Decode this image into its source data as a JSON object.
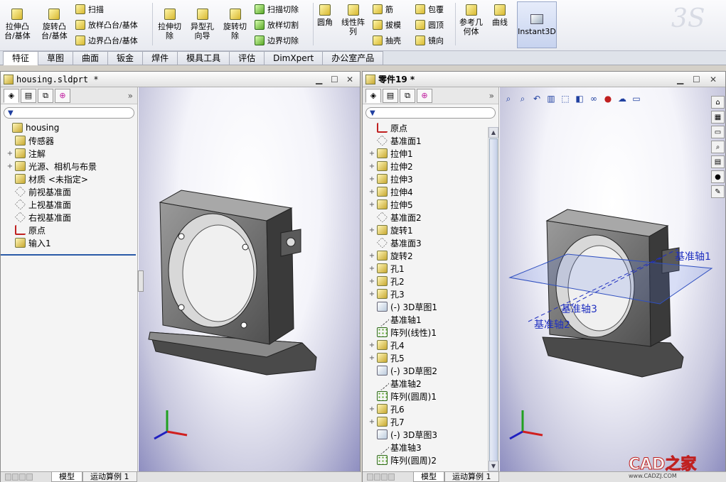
{
  "ribbon": {
    "big": [
      {
        "id": "extrude-boss",
        "label": "拉伸凸\n台/基体"
      },
      {
        "id": "revolve-boss",
        "label": "旋转凸\n台/基体"
      },
      {
        "id": "extrude-cut",
        "label": "拉伸切\n除"
      },
      {
        "id": "hole-wizard",
        "label": "异型孔\n向导"
      },
      {
        "id": "revolve-cut",
        "label": "旋转切\n除"
      },
      {
        "id": "fillet",
        "label": "圆角"
      },
      {
        "id": "linear-pattern",
        "label": "线性阵\n列"
      },
      {
        "id": "ref-geometry",
        "label": "参考几\n何体"
      },
      {
        "id": "curves",
        "label": "曲线"
      }
    ],
    "small": [
      {
        "id": "sweep",
        "label": "扫描"
      },
      {
        "id": "loft",
        "label": "放样凸台/基体"
      },
      {
        "id": "boundary-boss",
        "label": "边界凸台/基体"
      },
      {
        "id": "swept-cut",
        "label": "扫描切除"
      },
      {
        "id": "lofted-cut",
        "label": "放样切割"
      },
      {
        "id": "boundary-cut",
        "label": "边界切除"
      },
      {
        "id": "rib",
        "label": "筋"
      },
      {
        "id": "draft",
        "label": "拔模"
      },
      {
        "id": "shell",
        "label": "抽壳"
      },
      {
        "id": "wrap",
        "label": "包覆"
      },
      {
        "id": "dome",
        "label": "圆顶"
      },
      {
        "id": "mirror",
        "label": "镜向"
      }
    ],
    "instant3d": "Instant3D"
  },
  "tabs": [
    "特征",
    "草图",
    "曲面",
    "钣金",
    "焊件",
    "模具工具",
    "评估",
    "DimXpert",
    "办公室产品"
  ],
  "left_window": {
    "title": "housing.sldprt *",
    "tree": [
      {
        "label": "housing",
        "expand": "",
        "icon": "part",
        "indent": 0
      },
      {
        "label": "传感器",
        "expand": "",
        "icon": "feat",
        "indent": 1
      },
      {
        "label": "注解",
        "expand": "+",
        "icon": "feat",
        "indent": 1
      },
      {
        "label": "光源、相机与布景",
        "expand": "+",
        "icon": "feat",
        "indent": 1
      },
      {
        "label": "材质 <未指定>",
        "expand": "",
        "icon": "feat",
        "indent": 1
      },
      {
        "label": "前视基准面",
        "expand": "",
        "icon": "plane",
        "indent": 1
      },
      {
        "label": "上视基准面",
        "expand": "",
        "icon": "plane",
        "indent": 1
      },
      {
        "label": "右视基准面",
        "expand": "",
        "icon": "plane",
        "indent": 1
      },
      {
        "label": "原点",
        "expand": "",
        "icon": "origin",
        "indent": 1
      },
      {
        "label": "输入1",
        "expand": "",
        "icon": "feat",
        "indent": 1
      }
    ],
    "bottom_tabs": [
      "模型",
      "运动算例 1"
    ]
  },
  "right_window": {
    "title": "零件19 *",
    "tree": [
      {
        "label": "原点",
        "expand": "",
        "icon": "origin"
      },
      {
        "label": "基准面1",
        "expand": "",
        "icon": "plane"
      },
      {
        "label": "拉伸1",
        "expand": "+",
        "icon": "feat"
      },
      {
        "label": "拉伸2",
        "expand": "+",
        "icon": "feat"
      },
      {
        "label": "拉伸3",
        "expand": "+",
        "icon": "feat"
      },
      {
        "label": "拉伸4",
        "expand": "+",
        "icon": "feat"
      },
      {
        "label": "拉伸5",
        "expand": "+",
        "icon": "feat"
      },
      {
        "label": "基准面2",
        "expand": "",
        "icon": "plane"
      },
      {
        "label": "旋转1",
        "expand": "+",
        "icon": "feat"
      },
      {
        "label": "基准面3",
        "expand": "",
        "icon": "plane"
      },
      {
        "label": "旋转2",
        "expand": "+",
        "icon": "feat"
      },
      {
        "label": "孔1",
        "expand": "+",
        "icon": "feat"
      },
      {
        "label": "孔2",
        "expand": "+",
        "icon": "feat"
      },
      {
        "label": "孔3",
        "expand": "+",
        "icon": "feat"
      },
      {
        "label": "(-) 3D草图1",
        "expand": "",
        "icon": "sketch"
      },
      {
        "label": "基准轴1",
        "expand": "",
        "icon": "axis"
      },
      {
        "label": "阵列(线性)1",
        "expand": "",
        "icon": "pattern"
      },
      {
        "label": "孔4",
        "expand": "+",
        "icon": "feat"
      },
      {
        "label": "孔5",
        "expand": "+",
        "icon": "feat"
      },
      {
        "label": "(-) 3D草图2",
        "expand": "",
        "icon": "sketch"
      },
      {
        "label": "基准轴2",
        "expand": "",
        "icon": "axis"
      },
      {
        "label": "阵列(圆周)1",
        "expand": "",
        "icon": "pattern"
      },
      {
        "label": "孔6",
        "expand": "+",
        "icon": "feat"
      },
      {
        "label": "孔7",
        "expand": "+",
        "icon": "feat"
      },
      {
        "label": "(-) 3D草图3",
        "expand": "",
        "icon": "sketch"
      },
      {
        "label": "基准轴3",
        "expand": "",
        "icon": "axis"
      },
      {
        "label": "阵列(圆周)2",
        "expand": "",
        "icon": "pattern"
      }
    ],
    "bottom_tabs": [
      "模型",
      "运动算例 1"
    ],
    "axis_labels": {
      "axis1": "基准轴1",
      "axis2": "基准轴2",
      "axis3": "基准轴3"
    }
  },
  "watermark": "CAD之家",
  "watermark_url": "www.CADZJ.COM",
  "colors": {
    "axis_label": "#2030c0",
    "tree_line": "#2a5aa8"
  }
}
